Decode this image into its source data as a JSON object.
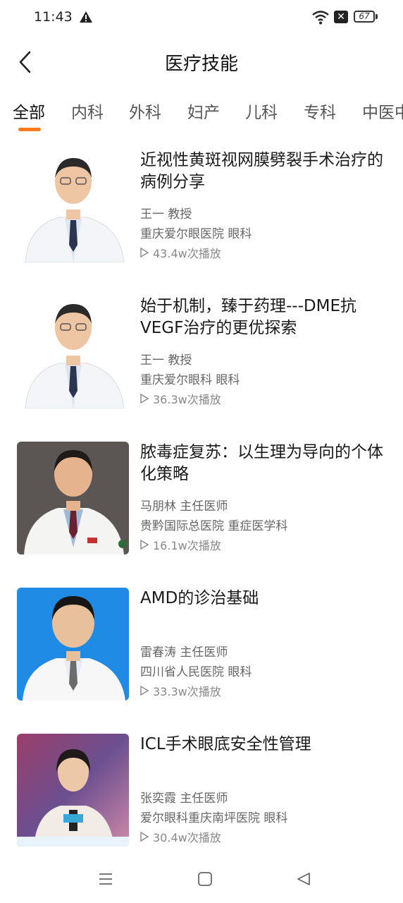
{
  "status_bar": {
    "time": "11:43",
    "battery": "67"
  },
  "header": {
    "title": "医疗技能"
  },
  "tabs": [
    {
      "label": "全部",
      "active": true
    },
    {
      "label": "内科"
    },
    {
      "label": "外科"
    },
    {
      "label": "妇产"
    },
    {
      "label": "儿科"
    },
    {
      "label": "专科"
    },
    {
      "label": "中医中"
    }
  ],
  "items": [
    {
      "title": "近视性黄斑视网膜劈裂手术治疗的病例分享",
      "doctor": "王一 教授",
      "hospital": "重庆爱尔眼医院 眼科",
      "plays": "43.4w次播放"
    },
    {
      "title": "始于机制，臻于药理---DME抗VEGF治疗的更优探索",
      "doctor": "王一 教授",
      "hospital": "重庆爱尔眼科 眼科",
      "plays": "36.3w次播放"
    },
    {
      "title": "脓毒症复苏：以生理为导向的个体化策略",
      "doctor": "马朋林 主任医师",
      "hospital": "贵黔国际总医院 重症医学科",
      "plays": "16.1w次播放"
    },
    {
      "title": "AMD的诊治基础",
      "doctor": "雷春涛 主任医师",
      "hospital": "四川省人民医院 眼科",
      "plays": "33.3w次播放"
    },
    {
      "title": "ICL手术眼底安全性管理",
      "doctor": "张奕霞 主任医师",
      "hospital": "爱尔眼科重庆南坪医院 眼科",
      "plays": "30.4w次播放"
    }
  ],
  "colors": {
    "accent": "#ff7a1a"
  }
}
